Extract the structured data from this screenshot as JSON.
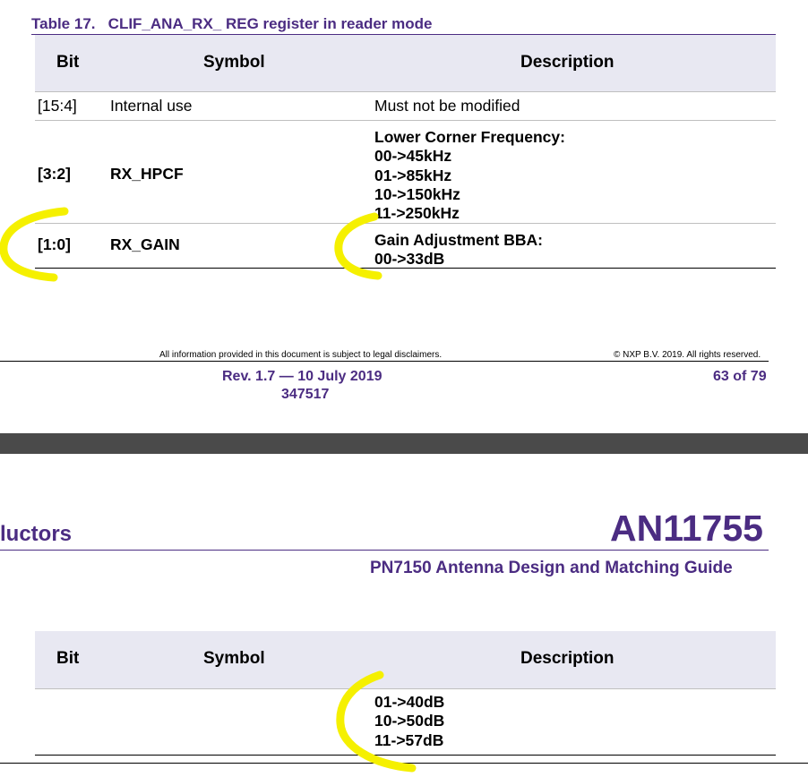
{
  "page1": {
    "caption": "Table 17.   CLIF_ANA_RX_ REG register in reader mode",
    "headers": {
      "bit": "Bit",
      "symbol": "Symbol",
      "description": "Description"
    },
    "rows": [
      {
        "bit": "[15:4]",
        "symbol": "Internal use",
        "desc": [
          "Must not be modified"
        ]
      },
      {
        "bit": "[3:2]",
        "symbol": "RX_HPCF",
        "desc": [
          "Lower Corner Frequency:",
          "00->45kHz",
          "01->85kHz",
          "10->150kHz",
          "11->250kHz"
        ]
      },
      {
        "bit": "[1:0]",
        "symbol": "RX_GAIN",
        "desc": [
          "Gain Adjustment BBA:",
          "00->33dB"
        ]
      }
    ],
    "footer": {
      "disclaimer": "All information provided in this document is subject to legal disclaimers.",
      "copyright": "© NXP B.V. 2019. All rights reserved.",
      "rev": "Rev. 1.7 — 10 July 2019",
      "doc_number": "347517",
      "page": "63 of 79"
    }
  },
  "page2": {
    "company_partial": "luctors",
    "doc_id": "AN11755",
    "doc_title": "PN7150 Antenna Design and Matching Guide",
    "headers": {
      "bit": "Bit",
      "symbol": "Symbol",
      "description": "Description"
    },
    "desc_lines": [
      "01->40dB",
      "10->50dB",
      "11->57dB"
    ]
  },
  "colors": {
    "brand": "#4b2c82",
    "header_bg": "#e8e8f2",
    "highlight": "#f5f000",
    "separator": "#4a4a4a"
  }
}
